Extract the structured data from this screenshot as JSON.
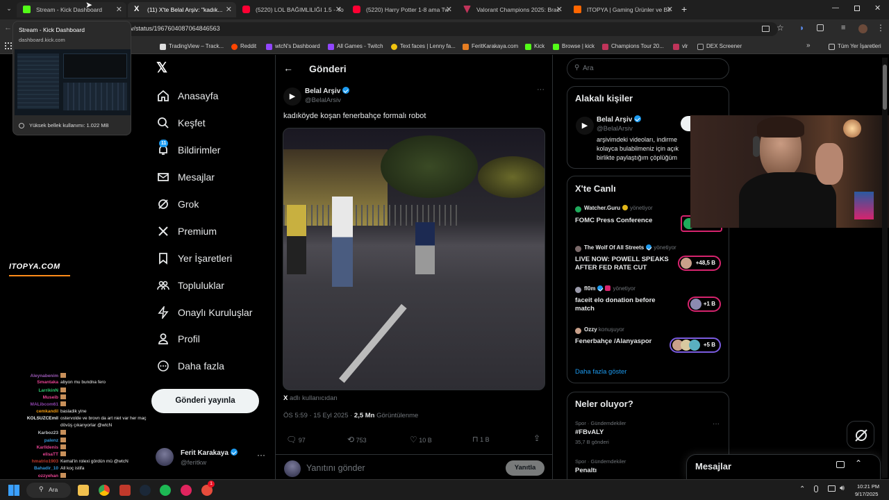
{
  "browser": {
    "tabs": [
      {
        "title": "Stream - Kick Dashboard"
      },
      {
        "title": "(11) X'te Belal Arşiv: \"kadık..."
      },
      {
        "title": "(5220) LOL BAĞIMLILIĞI 1.5 - Yo"
      },
      {
        "title": "(5220) Harry Potter 1-8 ama Tw"
      },
      {
        "title": "Valorant Champions 2025: Brac"
      },
      {
        "title": "ITOPYA | Gaming Ürünler ve Bil"
      }
    ],
    "url": "v/status/1967604087064846563",
    "tooltip": {
      "title": "Stream - Kick Dashboard",
      "domain": "dashboard.kick.com",
      "memory": "Yüksek bellek kullanımı: 1.022 MB"
    },
    "bookmarks": [
      "TradingView – Track...",
      "Reddit",
      "wtcN's Dashboard",
      "All Games - Twitch",
      "Text faces | Lenny fa...",
      "FeritKarakaya.com",
      "Kick",
      "Browse | kick",
      "Champions Tour 20...",
      "vlr",
      "DEX Screener"
    ],
    "all_bookmarks": "Tüm Yer İşaretleri"
  },
  "overlay_logo": "ITOPYA.COM",
  "sidebar": {
    "notif_badge": "11",
    "items": [
      "Anasayfa",
      "Keşfet",
      "Bildirimler",
      "Mesajlar",
      "Grok",
      "Premium",
      "Yer İşaretleri",
      "Topluluklar",
      "Onaylı Kuruluşlar",
      "Profil",
      "Daha fazla"
    ],
    "post_button": "Gönderi yayınla",
    "account": {
      "name": "Ferit Karakaya",
      "handle": "@feritkw"
    }
  },
  "post": {
    "header": "Gönderi",
    "author": "Belal Arşiv",
    "handle": "@BelalArsiv",
    "text": "kadıköyde koşan fenerbahçe formalı robot",
    "source_user": "adlı kullanıcıdan",
    "time": "ÖS 5:59 · 15 Eyl 2025 ·",
    "views": "2,5 Mn",
    "views_label": "Görüntülenme",
    "replies": "97",
    "reposts": "753",
    "likes": "10 B",
    "bookmarks": "1 B",
    "reply_placeholder": "Yanıtını gönder",
    "reply_button": "Yanıtla"
  },
  "right": {
    "search_placeholder": "Ara",
    "related": {
      "title": "Alakalı kişiler",
      "name": "Belal Arşiv",
      "handle": "@BelalArsiv",
      "bio": [
        "arşivimdeki videoları, indirme",
        "kolayca bulabilmeniz için açık",
        "birlikte paylaştığım çöplüğüm"
      ]
    },
    "live": {
      "title": "X'te Canlı",
      "items": [
        {
          "host": "Watcher.Guru",
          "role": "yönetiyor",
          "title": [
            "FOMC Press Conference"
          ],
          "count": ""
        },
        {
          "host": "The Wolf Of All Streets",
          "role": "yönetiyor",
          "title": [
            "LIVE NOW: POWELL SPEAKS",
            "AFTER FED RATE CUT"
          ],
          "count": "+48,5 B"
        },
        {
          "host": "fl0m",
          "role": "yönetiyor",
          "title": [
            "faceit elo donation before",
            "match"
          ],
          "count": "+1 B"
        },
        {
          "host": "Ozzy",
          "role": "konuşuyor",
          "title": [
            "Fenerbahçe /Alanyaspor"
          ],
          "count": "+5 B"
        }
      ],
      "more": "Daha fazla göster"
    },
    "trends": {
      "title": "Neler oluyor?",
      "items": [
        {
          "category": "Spor · Gündemdekiler",
          "tag": "#FBvALY",
          "count": "35,7 B gönderi"
        },
        {
          "category": "Spor · Gündemdekiler",
          "tag": "Penaltı",
          "count": ""
        }
      ]
    },
    "messages": "Mesajlar"
  },
  "chat": [
    {
      "user": "Aleynabenim",
      "msg": "",
      "color": "#9b59b6"
    },
    {
      "user": "Smantaka",
      "msg": "abyon mu bundna fero",
      "color": "#e84393"
    },
    {
      "user": "LarrikinN",
      "msg": "",
      "color": "#2ecc71"
    },
    {
      "user": "Museib",
      "msg": "",
      "color": "#e84393"
    },
    {
      "user": "MALibcom61",
      "msg": "",
      "color": "#8e44ad"
    },
    {
      "user": "cemkandil",
      "msg": "basladik yine",
      "color": "#f39c12"
    },
    {
      "user": "KOLSUZCEmil",
      "msg": "ostervolde ve brovn da art niet var her maç",
      "color": "#ecf0f1"
    },
    {
      "user": "",
      "msg": "dövüş çıkarıyorlar @wtcN",
      "color": "#ecf0f1"
    },
    {
      "user": "Karboz23",
      "msg": "",
      "color": "#bdc3c7"
    },
    {
      "user": "palenz",
      "msg": "",
      "color": "#3498db"
    },
    {
      "user": "Karlldenis",
      "msg": "",
      "color": "#e84393"
    },
    {
      "user": "elisaTT",
      "msg": "",
      "color": "#e84393"
    },
    {
      "user": "hmatrio1903",
      "msg": "Kemal'in rolexi gördün mü @wtcN",
      "color": "#c0392b"
    },
    {
      "user": "Bahadir_10",
      "msg": "All koç istifa",
      "color": "#3498db"
    },
    {
      "user": "ozzyehan",
      "msg": "",
      "color": "#e84393"
    }
  ],
  "taskbar": {
    "search": "Ara",
    "time": "10:21 PM",
    "date": "9/17/2025",
    "badge": "1"
  },
  "colors": {
    "accent": "#1d9bf0",
    "live": "#d6246e",
    "kick": "#53fc18"
  }
}
